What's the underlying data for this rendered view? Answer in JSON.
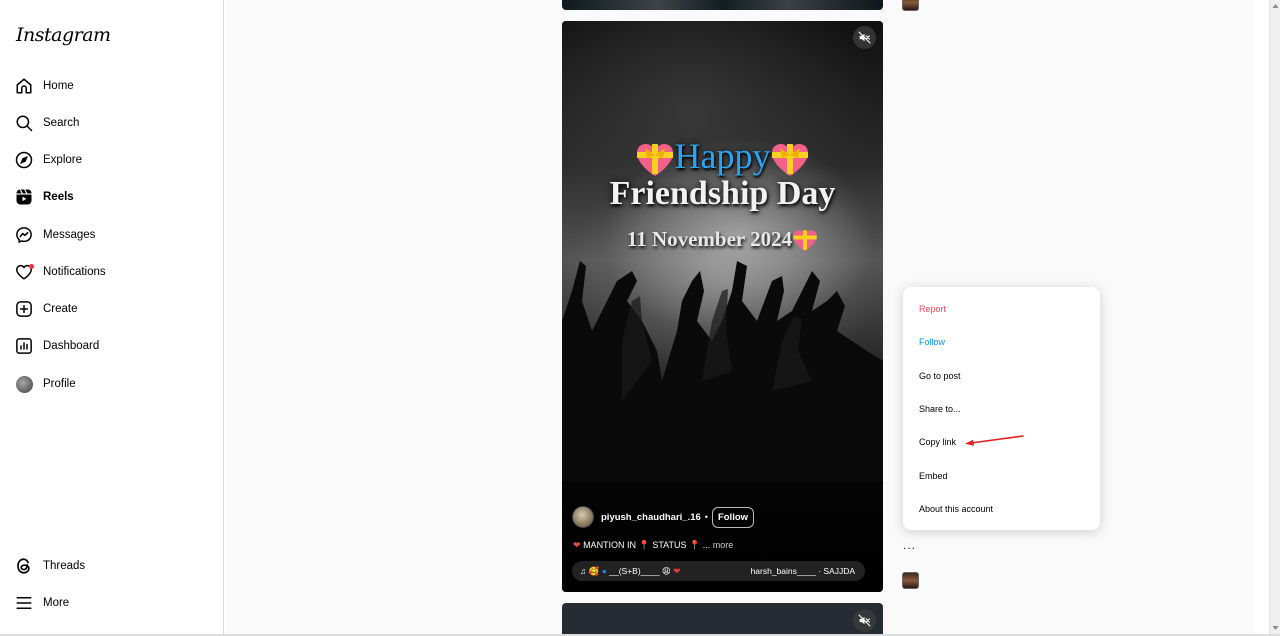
{
  "app": {
    "logo": "Instagram"
  },
  "sidebar": {
    "items": [
      {
        "label": "Home",
        "icon": "home-icon"
      },
      {
        "label": "Search",
        "icon": "search-icon"
      },
      {
        "label": "Explore",
        "icon": "compass-icon"
      },
      {
        "label": "Reels",
        "icon": "reels-icon",
        "active": true
      },
      {
        "label": "Messages",
        "icon": "messenger-icon"
      },
      {
        "label": "Notifications",
        "icon": "heart-icon",
        "badge": true
      },
      {
        "label": "Create",
        "icon": "plus-square-icon"
      },
      {
        "label": "Dashboard",
        "icon": "dashboard-icon"
      },
      {
        "label": "Profile",
        "icon": "avatar"
      }
    ],
    "bottom_items": [
      {
        "label": "Threads",
        "icon": "threads-icon"
      },
      {
        "label": "More",
        "icon": "hamburger-icon"
      }
    ]
  },
  "reel": {
    "title_line1": "Happy",
    "title_line2": "Friendship Day",
    "title_line3": "11 November 2024",
    "author": "piyush_chaudhari_.16",
    "separator": "•",
    "follow_label": "Follow",
    "caption_prefix": "MANTION IN",
    "caption_mid": "STATUS",
    "caption_ellipsis": "...",
    "caption_more": "more",
    "audio_left": "__(S+B)____",
    "audio_right": "harsh_bains____ · SAJJDA",
    "muted": true
  },
  "menu": {
    "items": [
      {
        "label": "Report",
        "style": "red"
      },
      {
        "label": "Follow",
        "style": "blue"
      },
      {
        "label": "Go to post"
      },
      {
        "label": "Share to..."
      },
      {
        "label": "Copy link",
        "highlighted_with_arrow": true
      },
      {
        "label": "Embed"
      },
      {
        "label": "About this account"
      }
    ]
  },
  "actions": {
    "more_label": "..."
  },
  "colors": {
    "report": "#ed4956",
    "follow": "#0095f6",
    "notification_dot": "#ff3040",
    "annotation_arrow": "#e02020",
    "happy_text": "#2aa4f4"
  }
}
